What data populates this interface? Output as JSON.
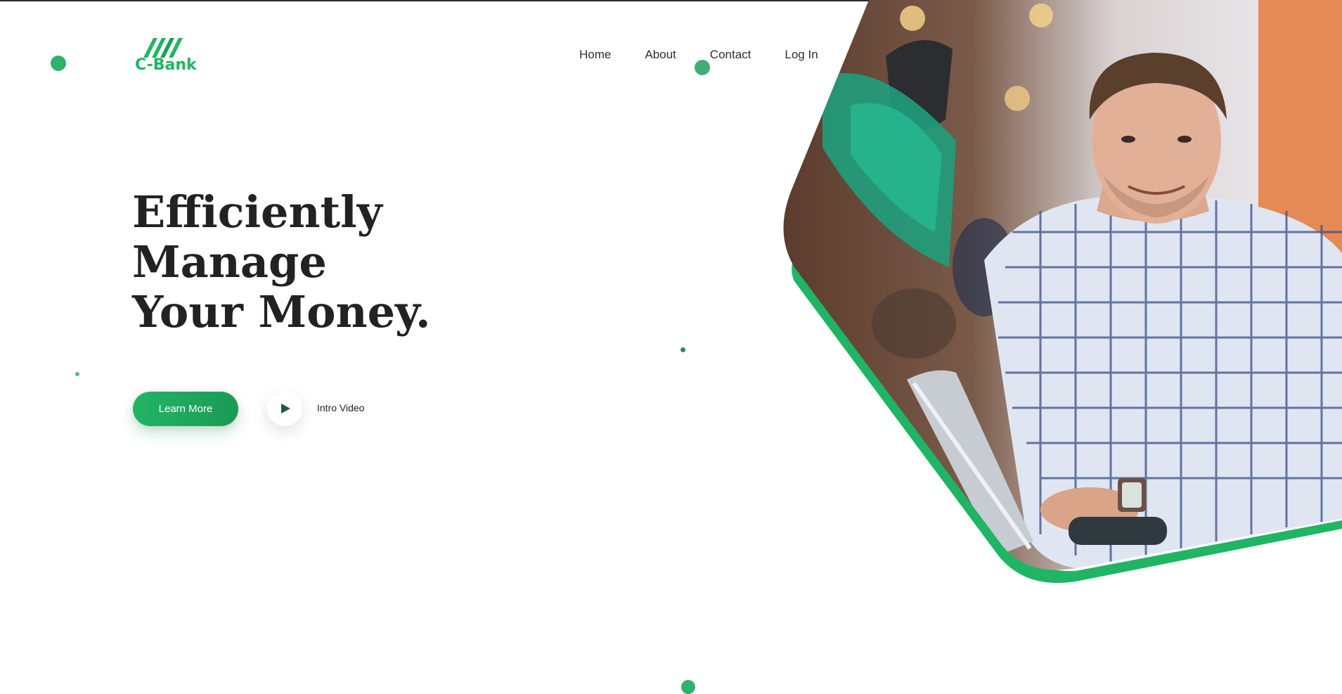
{
  "brand": {
    "name": "C-Bank",
    "color": "#1fb564",
    "logo_icon": "stripes-logo-icon"
  },
  "nav": {
    "items": [
      {
        "label": "Home"
      },
      {
        "label": "About"
      },
      {
        "label": "Contact"
      },
      {
        "label": "Log In"
      }
    ]
  },
  "hero": {
    "title_lines": [
      "Efficiently",
      "Manage",
      "Your Money."
    ],
    "primary_button": "Learn More",
    "video_button_icon": "play-icon",
    "video_label": "Intro Video"
  },
  "colors": {
    "accent": "#1fb564",
    "accent_dark": "#1b9a55",
    "text": "#222222"
  }
}
